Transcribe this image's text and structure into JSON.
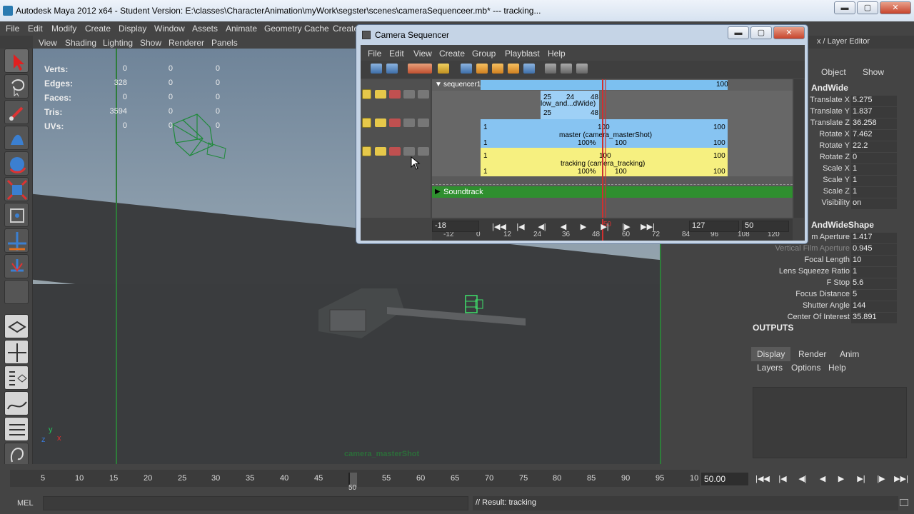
{
  "app": {
    "title": "Autodesk Maya 2012 x64 - Student Version: E:\\classes\\CharacterAnimation\\myWork\\segster\\scenes\\cameraSequenceer.mb*   ---   tracking...",
    "win_min": "▬",
    "win_max": "▢",
    "win_close": "✕"
  },
  "menubar": [
    "File",
    "Edit",
    "Modify",
    "Create",
    "Display",
    "Window",
    "Assets",
    "Animate",
    "Geometry Cache",
    "Create"
  ],
  "viewport": {
    "menu": [
      "View",
      "Shading",
      "Lighting",
      "Show",
      "Renderer",
      "Panels"
    ],
    "hud": [
      {
        "label": "Verts:",
        "a": "0",
        "b": "0",
        "c": "0"
      },
      {
        "label": "Edges:",
        "a": "328",
        "b": "0",
        "c": "0"
      },
      {
        "label": "Faces:",
        "a": "0",
        "b": "0",
        "c": "0"
      },
      {
        "label": "Tris:",
        "a": "3594",
        "b": "0",
        "c": "0"
      },
      {
        "label": "UVs:",
        "a": "0",
        "b": "0",
        "c": "0"
      }
    ],
    "camera_label": "camera_masterShot",
    "axis_y": "y",
    "axis_x": "x",
    "axis_z": "z"
  },
  "sequencer": {
    "title": "Camera Sequencer",
    "menu": [
      "File",
      "Edit",
      "View",
      "Create",
      "Group",
      "Playblast",
      "Help"
    ],
    "sequencer_label": "sequencer1",
    "sequencer_end": "100",
    "shot_wide": {
      "label": "low_and...dWide)",
      "a": "25",
      "b": "24",
      "c": "48",
      "d": "25",
      "e": "48"
    },
    "shot_master": {
      "label": "master (camera_masterShot)",
      "start": "1",
      "end": "100",
      "start2": "1",
      "pct": "100%",
      "frame": "100",
      "end2": "100",
      "head": "100"
    },
    "shot_tracking": {
      "label": "tracking (camera_tracking)",
      "start": "1",
      "end": "100",
      "start2": "1",
      "pct": "100%",
      "frame": "100",
      "end2": "100",
      "head": "100"
    },
    "soundtrack": "Soundtrack",
    "ruler": [
      "-12",
      "0",
      "12",
      "24",
      "36",
      "48",
      "60",
      "72",
      "84",
      "96",
      "108",
      "120"
    ],
    "playhead_label": "50",
    "range_start": "-18",
    "range_end": "127",
    "current": "50"
  },
  "transport": [
    "|◀◀",
    "|◀",
    "◀|",
    "◀",
    "▶",
    "▶|",
    "|▶",
    "▶▶|"
  ],
  "channelbox": {
    "menu_header": "x / Layer Editor",
    "tabs": [
      "Object",
      "Show"
    ],
    "node1": "AndWide",
    "attrs1": [
      {
        "label": "Translate X",
        "value": "5.275"
      },
      {
        "label": "Translate Y",
        "value": "1.837"
      },
      {
        "label": "Translate Z",
        "value": "36.258"
      },
      {
        "label": "Rotate X",
        "value": "7.462"
      },
      {
        "label": "Rotate Y",
        "value": "22.2"
      },
      {
        "label": "Rotate Z",
        "value": "0"
      },
      {
        "label": "Scale X",
        "value": "1"
      },
      {
        "label": "Scale Y",
        "value": "1"
      },
      {
        "label": "Scale Z",
        "value": "1"
      },
      {
        "label": "Visibility",
        "value": "on"
      }
    ],
    "node2": "AndWideShape",
    "attrs2": [
      {
        "label": "m Aperture",
        "value": "1.417"
      },
      {
        "label": "Vertical Film Aperture",
        "value": "0.945"
      },
      {
        "label": "Focal Length",
        "value": "10"
      },
      {
        "label": "Lens Squeeze Ratio",
        "value": "1"
      },
      {
        "label": "F Stop",
        "value": "5.6"
      },
      {
        "label": "Focus Distance",
        "value": "5"
      },
      {
        "label": "Shutter Angle",
        "value": "144"
      },
      {
        "label": "Center Of Interest",
        "value": "35.891"
      }
    ],
    "outputs": "OUTPUTS",
    "layer_tabs": [
      "Display",
      "Render",
      "Anim"
    ],
    "layer_menu": [
      "Layers",
      "Options",
      "Help"
    ]
  },
  "timeslider": {
    "ticks": [
      "5",
      "10",
      "15",
      "20",
      "25",
      "30",
      "35",
      "40",
      "45",
      "50",
      "55",
      "60",
      "65",
      "70",
      "75",
      "80",
      "85",
      "90",
      "95",
      "10"
    ],
    "current_marker": "50",
    "current_field": "50.00"
  },
  "cmdline": {
    "mel": "MEL",
    "result": "// Result: tracking"
  }
}
